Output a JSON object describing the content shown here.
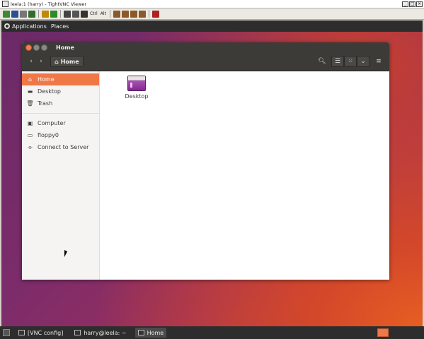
{
  "vnc": {
    "window_title": "leela:1 (harry) - TightVNC Viewer",
    "toolbar_text": [
      "Ctrl",
      "Alt"
    ]
  },
  "desktop_panel": {
    "applications": "Applications",
    "places": "Places"
  },
  "file_manager": {
    "window_title": "Home",
    "path_button": "Home",
    "sidebar": [
      {
        "label": "Home",
        "icon": "home-icon",
        "active": true
      },
      {
        "label": "Desktop",
        "icon": "desktop-icon"
      },
      {
        "label": "Trash",
        "icon": "trash-icon"
      },
      {
        "label": "Computer",
        "icon": "computer-icon"
      },
      {
        "label": "floppy0",
        "icon": "floppy-icon"
      },
      {
        "label": "Connect to Server",
        "icon": "server-icon"
      }
    ],
    "files": [
      {
        "label": "Desktop",
        "icon": "folder-desktop-icon"
      }
    ]
  },
  "taskbar": {
    "tasks": [
      {
        "label": "[VNC config]"
      },
      {
        "label": "harry@leela: ~"
      },
      {
        "label": "Home",
        "active": true
      }
    ]
  },
  "colors": {
    "accent": "#f07746",
    "panel": "#2d2d2d",
    "titlebar": "#3c3b37"
  }
}
